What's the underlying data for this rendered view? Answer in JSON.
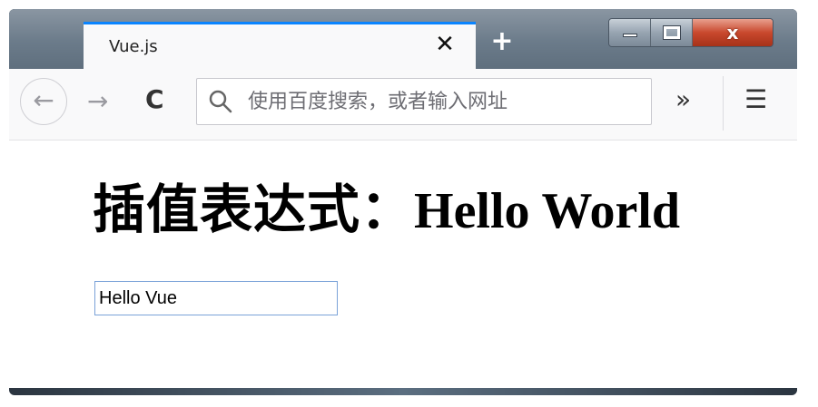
{
  "window": {
    "close_glyph": "x"
  },
  "tab": {
    "title": "Vue.js",
    "close_glyph": "✕"
  },
  "new_tab_glyph": "+",
  "navbar": {
    "back_glyph": "←",
    "forward_glyph": "→",
    "reload_glyph": "C",
    "url_placeholder": "使用百度搜索，或者输入网址",
    "overflow_glyph": "»",
    "menu_glyph": "☰"
  },
  "page": {
    "heading_label": "插值表达式：",
    "heading_value": "Hello World",
    "input_value": "Hello Vue"
  },
  "colors": {
    "tab_accent": "#0a84ff",
    "close_button": "#c9482d"
  }
}
